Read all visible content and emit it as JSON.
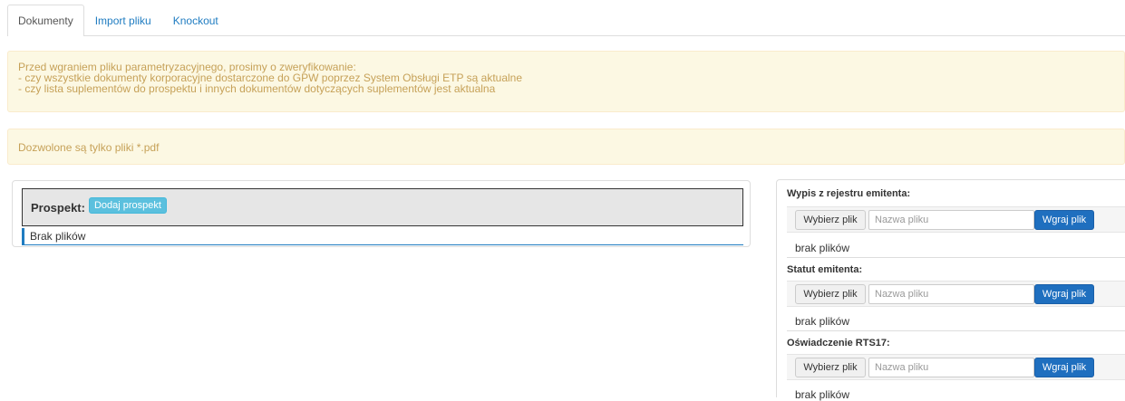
{
  "tabs": [
    {
      "label": "Dokumenty",
      "active": true
    },
    {
      "label": "Import pliku",
      "active": false
    },
    {
      "label": "Knockout",
      "active": false
    }
  ],
  "alert_info": {
    "line1": "Przed wgraniem pliku parametryzacyjnego, prosimy o zweryfikowanie:",
    "line2": "- czy wszystkie dokumenty korporacyjne dostarczone do GPW poprzez System Obsługi ETP są aktualne",
    "line3": "- czy lista suplementów do prospektu i innych dokumentów dotyczących suplementów jest aktualna"
  },
  "alert_pdf": "Dozwolone są tylko pliki *.pdf",
  "prospekt": {
    "label": "Prospekt:",
    "add_button": "Dodaj prospekt",
    "empty_text": "Brak plików"
  },
  "upload_sections": [
    {
      "title": "Wypis z rejestru emitenta:",
      "choose_label": "Wybierz plik",
      "placeholder": "Nazwa pliku",
      "upload_label": "Wgraj plik",
      "empty_text": "brak plików"
    },
    {
      "title": "Statut emitenta:",
      "choose_label": "Wybierz plik",
      "placeholder": "Nazwa pliku",
      "upload_label": "Wgraj plik",
      "empty_text": "brak plików"
    },
    {
      "title": "Oświadczenie RTS17:",
      "choose_label": "Wybierz plik",
      "placeholder": "Nazwa pliku",
      "upload_label": "Wgraj plik",
      "empty_text": "brak plików"
    }
  ],
  "colors": {
    "link": "#1f7cc1",
    "warning_bg": "#fcf8e3",
    "warning_text": "#c6a158",
    "info_button": "#5bc0de",
    "primary_button": "#1f6fbf"
  }
}
